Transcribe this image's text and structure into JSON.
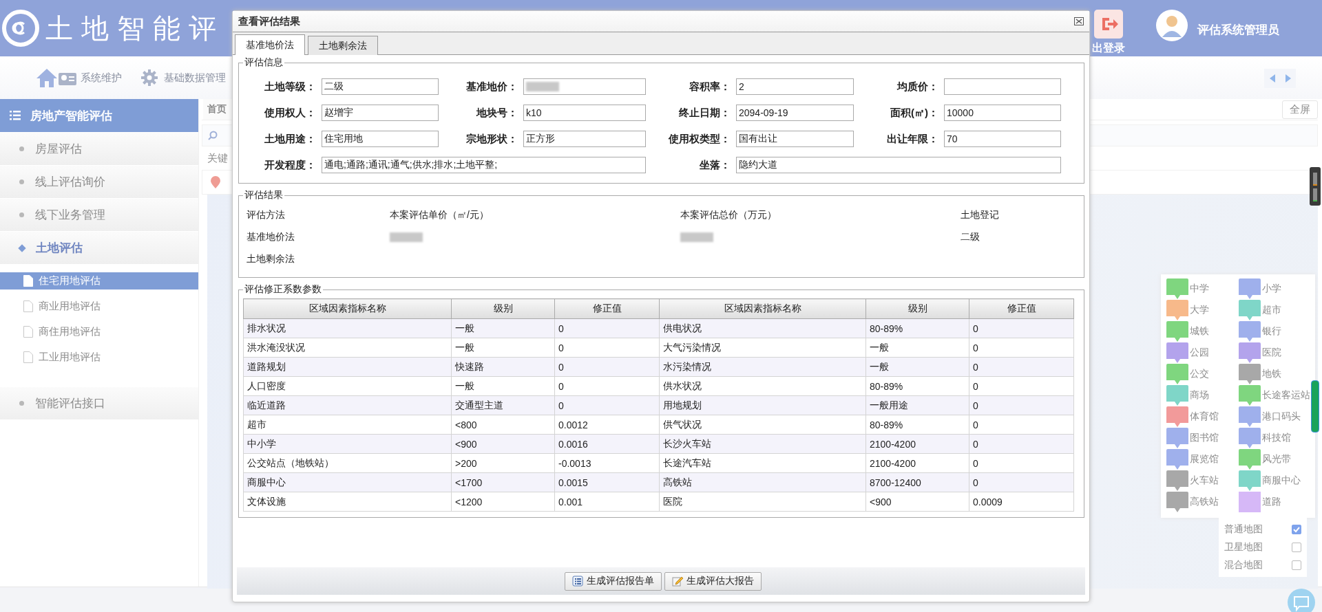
{
  "header": {
    "title": "土地智能评",
    "logout_label": "出登录",
    "user_name": "评估系统管理员"
  },
  "nav": {
    "items": [
      {
        "label": "系统维护"
      },
      {
        "label": "基础数据管理"
      }
    ]
  },
  "sidebar": {
    "title": "房地产智能评估",
    "items": [
      {
        "label": "房屋评估",
        "expanded": false
      },
      {
        "label": "线上评估询价",
        "expanded": false
      },
      {
        "label": "线下业务管理",
        "expanded": false
      },
      {
        "label": "土地评估",
        "expanded": true,
        "children": [
          {
            "label": "住宅用地评估",
            "selected": true
          },
          {
            "label": "商业用地评估",
            "selected": false
          },
          {
            "label": "商住用地评估",
            "selected": false
          },
          {
            "label": "工业用地评估",
            "selected": false
          }
        ]
      },
      {
        "label": "智能评估接口",
        "expanded": false
      }
    ]
  },
  "main": {
    "tab": "首页",
    "search_label": "关键",
    "fullscreen_button": "全屏"
  },
  "map": {
    "legend": [
      {
        "label": "中学",
        "kind": "marker",
        "color": "#7fd67f"
      },
      {
        "label": "小学",
        "kind": "marker",
        "color": "#9fb0ec"
      },
      {
        "label": "大学",
        "kind": "marker",
        "color": "#f7b98a"
      },
      {
        "label": "超市",
        "kind": "marker",
        "color": "#7fd6c8"
      },
      {
        "label": "城铁",
        "kind": "marker",
        "color": "#7fd67f"
      },
      {
        "label": "银行",
        "kind": "marker",
        "color": "#9fb0ec"
      },
      {
        "label": "公园",
        "kind": "marker",
        "color": "#b3a3ec"
      },
      {
        "label": "医院",
        "kind": "marker",
        "color": "#b3a3ec"
      },
      {
        "label": "公交",
        "kind": "marker",
        "color": "#7fd67f"
      },
      {
        "label": "地铁",
        "kind": "marker",
        "color": "#a8a8a8"
      },
      {
        "label": "商场",
        "kind": "marker",
        "color": "#7fd6c8"
      },
      {
        "label": "长途客运站",
        "kind": "marker",
        "color": "#7fd67f"
      },
      {
        "label": "体育馆",
        "kind": "marker",
        "color": "#f29a9a"
      },
      {
        "label": "港口码头",
        "kind": "marker",
        "color": "#9fb0ec"
      },
      {
        "label": "图书馆",
        "kind": "marker",
        "color": "#9fb0ec"
      },
      {
        "label": "科技馆",
        "kind": "marker",
        "color": "#9fb0ec"
      },
      {
        "label": "展览馆",
        "kind": "marker",
        "color": "#9fb0ec"
      },
      {
        "label": "风光带",
        "kind": "marker",
        "color": "#7fd67f"
      },
      {
        "label": "火车站",
        "kind": "marker",
        "color": "#a8a8a8"
      },
      {
        "label": "商服中心",
        "kind": "marker",
        "color": "#7fd6c8"
      },
      {
        "label": "高铁站",
        "kind": "marker",
        "color": "#a8a8a8"
      },
      {
        "label": "道路",
        "kind": "swatch",
        "color": "#d6b8f7"
      }
    ],
    "layers": [
      {
        "label": "普通地图",
        "checked": true
      },
      {
        "label": "卫星地图",
        "checked": false
      },
      {
        "label": "混合地图",
        "checked": false
      }
    ]
  },
  "dialog": {
    "title": "查看评估结果",
    "tabs": [
      {
        "label": "基准地价法",
        "selected": true
      },
      {
        "label": "土地剩余法",
        "selected": false
      }
    ],
    "info": {
      "legend": "评估信息",
      "fields": [
        {
          "label": "土地等级：",
          "value": "二级",
          "wide": false,
          "redacted": false
        },
        {
          "label": "基准地价：",
          "wide": false,
          "redacted": true
        },
        {
          "label": "容积率：",
          "value": "2",
          "wide": false,
          "redacted": false
        },
        {
          "label": "均质价：",
          "wide": false,
          "redacted": false
        },
        {
          "label": "使用权人：",
          "value": "赵增宇",
          "wide": false,
          "redacted": false
        },
        {
          "label": "地块号：",
          "value": "k10",
          "wide": false,
          "redacted": false
        },
        {
          "label": "终止日期：",
          "value": "2094-09-19",
          "wide": false,
          "redacted": false
        },
        {
          "label": "面积(㎡)：",
          "value": "10000",
          "wide": false,
          "redacted": false
        },
        {
          "label": "土地用途：",
          "value": "住宅用地",
          "wide": false,
          "redacted": false
        },
        {
          "label": "宗地形状：",
          "value": "正方形",
          "wide": false,
          "redacted": false
        },
        {
          "label": "使用权类型：",
          "value": "国有出让",
          "wide": false,
          "redacted": false
        },
        {
          "label": "出让年限：",
          "value": "70",
          "wide": false,
          "redacted": false
        },
        {
          "label": "开发程度：",
          "value": "通电;通路;通讯;通气;供水;排水;土地平整;",
          "wide": true,
          "redacted": false
        },
        {
          "label": "坐落：",
          "value": "隐约大道",
          "wide": true,
          "redacted": false
        }
      ]
    },
    "results": {
      "legend": "评估结果",
      "columns": [
        "评估方法",
        "本案评估单价（㎡/元）",
        "本案评估总价（万元）",
        "土地登记"
      ],
      "rows": [
        [
          {
            "text": "基准地价法",
            "redacted": false
          },
          {
            "redacted": true
          },
          {
            "redacted": true
          },
          {
            "text": "二级",
            "redacted": false
          }
        ],
        [
          {
            "text": "土地剩余法",
            "redacted": false
          }
        ]
      ]
    },
    "factors": {
      "legend": "评估修正系数参数",
      "columns": [
        "区域因素指标名称",
        "级别",
        "修正值",
        "区域因素指标名称",
        "级别",
        "修正值"
      ],
      "rows": [
        [
          "排水状况",
          "一般",
          "0",
          "供电状况",
          "80-89%",
          "0"
        ],
        [
          "洪水淹没状况",
          "一般",
          "0",
          "大气污染情况",
          "一般",
          "0"
        ],
        [
          "道路规划",
          "快速路",
          "0",
          "水污染情况",
          "一般",
          "0"
        ],
        [
          "人口密度",
          "一般",
          "0",
          "供水状况",
          "80-89%",
          "0"
        ],
        [
          "临近道路",
          "交通型主道",
          "0",
          "用地规划",
          "一般用途",
          "0"
        ],
        [
          "超市",
          "<800",
          "0.0012",
          "供气状况",
          "80-89%",
          "0"
        ],
        [
          "中小学",
          "<900",
          "0.0016",
          "长沙火车站",
          "2100-4200",
          "0"
        ],
        [
          "公交站点（地铁站）",
          ">200",
          "-0.0013",
          "长途汽车站",
          "2100-4200",
          "0"
        ],
        [
          "商服中心",
          "<1700",
          "0.0015",
          "高铁站",
          "8700-12400",
          "0"
        ],
        [
          "文体设施",
          "<1200",
          "0.001",
          "医院",
          "<900",
          "0.0009"
        ]
      ]
    },
    "buttons": [
      {
        "label": "生成评估报告单"
      },
      {
        "label": "生成评估大报告"
      }
    ]
  }
}
